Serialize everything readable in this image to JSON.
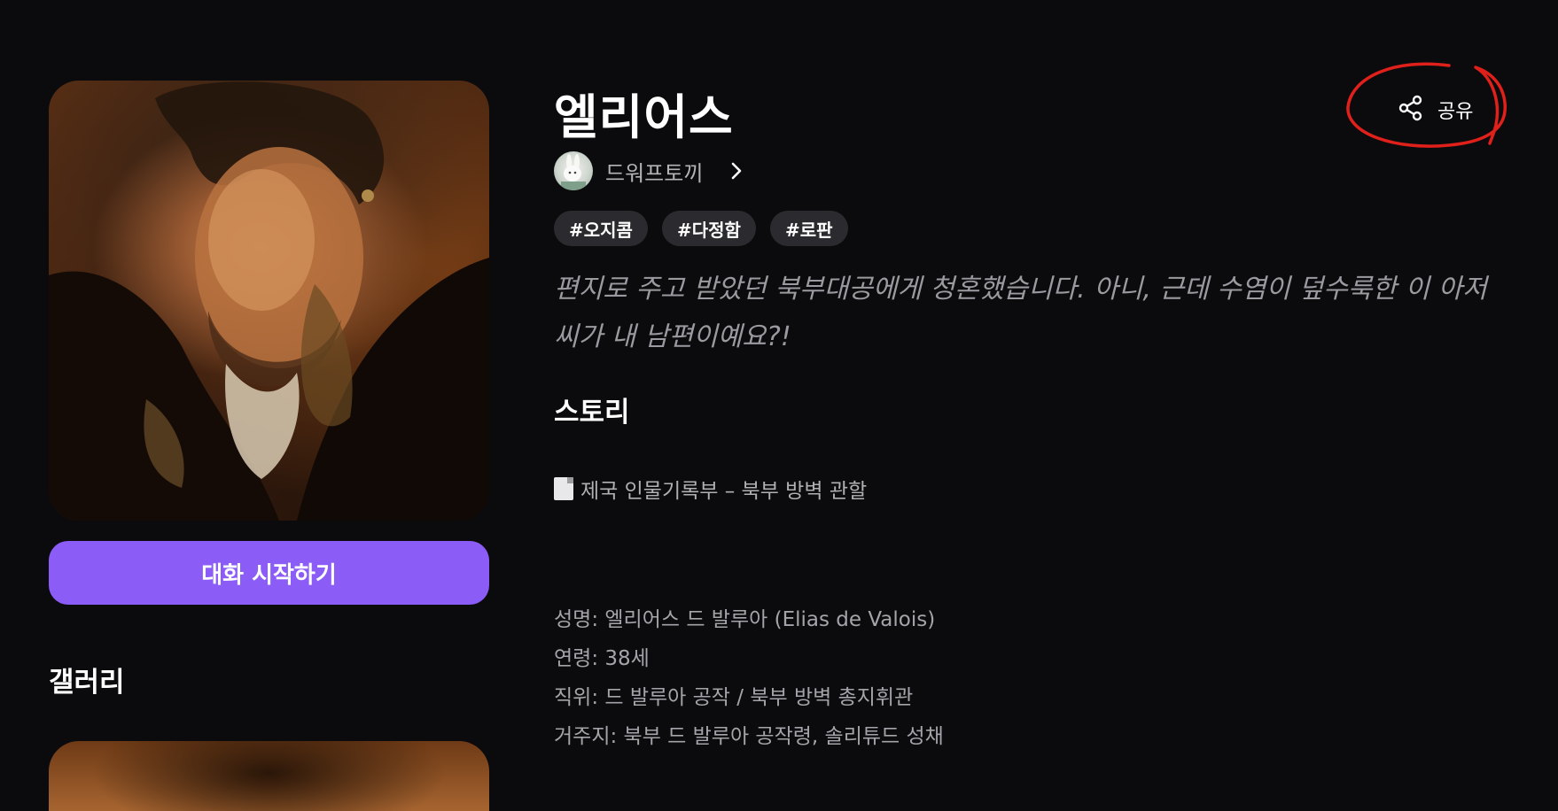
{
  "character": {
    "name": "엘리어스",
    "creator": "드워프토끼",
    "tags": [
      "#오지콤",
      "#다정함",
      "#로판"
    ],
    "tagline": "편지로 주고 받았던 북부대공에게 청혼했습니다. 아니, 근데 수염이 덮수룩한 이 아저씨가 내 남편이예요?!"
  },
  "actions": {
    "start_chat": "대화 시작하기",
    "share": "공유"
  },
  "gallery": {
    "title": "갤러리"
  },
  "story": {
    "heading": "스토리",
    "doc_title": "제국 인물기록부 – 북부 방벽 관할",
    "info": [
      "성명: 엘리어스 드 발루아 (Elias de Valois)",
      "연령: 38세",
      "직위: 드 발루아 공작 / 북부 방벽 총지휘관",
      "거주지: 북부 드 발루아 공작령, 솔리튜드 성채"
    ]
  },
  "colors": {
    "background": "#0b0b0d",
    "accent": "#8b5cf6",
    "tag_bg": "#2b2b2f",
    "annotation": "#e0201a"
  },
  "icons": {
    "share": "share-icon",
    "chevron": "chevron-right-icon",
    "doc": "document-icon"
  }
}
